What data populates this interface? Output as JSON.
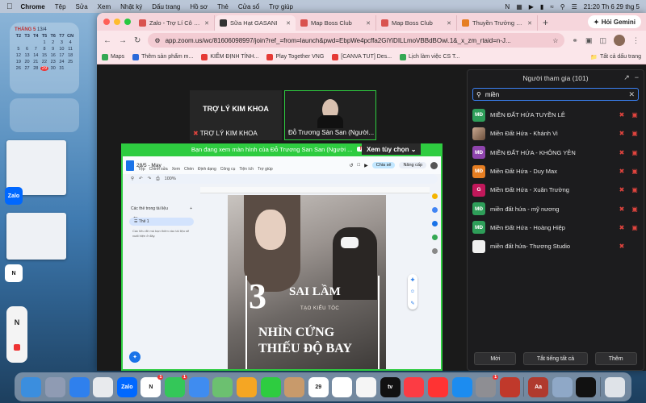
{
  "menubar": {
    "app": "Chrome",
    "items": [
      "Tệp",
      "Sửa",
      "Xem",
      "Nhật ký",
      "Dấu trang",
      "Hồ sơ",
      "Thẻ",
      "Cửa sổ",
      "Trợ giúp"
    ],
    "datetime": "21:20 Th 6 29 thg 5"
  },
  "calendar": {
    "month": "THÁNG 5",
    "year_label": "13/4",
    "days": [
      "T2",
      "T3",
      "T4",
      "T5",
      "T6",
      "T7",
      "CN"
    ],
    "dates": [
      "",
      "",
      "",
      "1",
      "2",
      "3",
      "4",
      "5",
      "6",
      "7",
      "8",
      "9",
      "10",
      "11",
      "12",
      "13",
      "14",
      "15",
      "16",
      "17",
      "18",
      "19",
      "20",
      "21",
      "22",
      "23",
      "24",
      "25",
      "26",
      "27",
      "28",
      "29",
      "30",
      "31"
    ],
    "today": "29"
  },
  "desktop": {
    "zalo_label": "Zalo"
  },
  "browser": {
    "tabs": [
      {
        "title": "Zalo - Trợ Lí Cô San",
        "color": "#d9534f"
      },
      {
        "title": "Sữa Hạt GASANI",
        "color": "#333333"
      },
      {
        "title": "Map Boss Club",
        "color": "#d9534f"
      },
      {
        "title": "Map Boss Club",
        "color": "#d9534f"
      },
      {
        "title": "Thuyền Trưởng x5 -",
        "color": "#e67e22"
      }
    ],
    "gemini_label": "Hỏi Gemini",
    "url": "app.zoom.us/wc/81606098997/join?ref_=from=launch&pwd=EbpWe4pcffa2GiYiDILLmoVBBdBOwi.1&_x_zm_rtaid=n-J...",
    "bookmarks": [
      {
        "label": "Maps",
        "color": "#34a853"
      },
      {
        "label": "Thêm sản phẩm m...",
        "color": "#2a6ad9"
      },
      {
        "label": "KIỂM ĐỊNH TÍNH...",
        "color": "#e53935"
      },
      {
        "label": "Play Together VNG",
        "color": "#e53935"
      },
      {
        "label": "[CANVA TUT] Des...",
        "color": "#e53935"
      },
      {
        "label": "Lịch làm việc CS T...",
        "color": "#34a853"
      }
    ],
    "all_bookmarks": "Tất cả dấu trang"
  },
  "zoom": {
    "tiles": [
      {
        "big": "TRỢ LÝ KIM KHOA",
        "name": "TRỢ LÝ KIM KHOA"
      },
      {
        "big": "",
        "name": "Đỗ Trương Sàn San (Người..."
      }
    ],
    "share_notice": "Bạn đang xem màn hình của  Đỗ Trương San San (Người ...",
    "rec": "REC",
    "view_options": "Xem tùy chọn",
    "docs": {
      "title": "28/5 - May",
      "menu": [
        "Tệp",
        "Chỉnh sửa",
        "Xem",
        "Chèn",
        "Định dạng",
        "Công cụ",
        "Tiện ích",
        "Trợ giúp"
      ],
      "share": "Chia sẻ",
      "upgrade": "Nâng cấp",
      "zoom": "100%",
      "sidebar_header": "Các thẻ trong tài liệu",
      "tab1": "Thẻ 1",
      "hint": "Các tiêu đề mà bạn thêm vào tài liệu sẽ xuất hiện ở đây.",
      "poster": {
        "num": "3",
        "line1": "SAI LẦM",
        "line2": "TẠO KIỂU TÓC",
        "line3": "NHÌN CỨNG",
        "line4": "THIẾU ĐỘ BAY"
      }
    },
    "participants": {
      "title": "Người tham gia (101)",
      "search": "miền",
      "list": [
        {
          "initials": "MĐ",
          "name": "MIỀN ĐẤT HỨA TUYỀN LÊ",
          "color": "#2e9e59",
          "cam": true
        },
        {
          "initials": "",
          "name": "Miền Đất Hứa - Khánh Vi",
          "color": "",
          "cam": true
        },
        {
          "initials": "MĐ",
          "name": "MIỀN ĐẤT HỨA - KHÔNG YÊN",
          "color": "#8e44ad",
          "cam": true
        },
        {
          "initials": "MĐ",
          "name": "Miền Đất Hứa - Duy Max",
          "color": "#e67e22",
          "cam": true
        },
        {
          "initials": "G",
          "name": "Miền Đất Hứa - Xuân Trường",
          "color": "#c2185b",
          "cam": true
        },
        {
          "initials": "MĐ",
          "name": "miền đất hứa - mỹ nương",
          "color": "#2e9e59",
          "cam": true
        },
        {
          "initials": "MĐ",
          "name": "Miền Đất Hứa - Hoàng Hiệp",
          "color": "#2e9e59",
          "cam": true
        },
        {
          "initials": "",
          "name": "miền đất hứa- Thương Studio",
          "color": "#f0f0f0",
          "cam": false
        }
      ],
      "invite": "Mời",
      "mute_all": "Tắt tiếng tất cả",
      "more": "Thêm"
    }
  },
  "dock": {
    "apps": [
      {
        "name": "finder-icon",
        "color": "#3b8ede",
        "label": ""
      },
      {
        "name": "launchpad-icon",
        "color": "#8f9bb3",
        "label": ""
      },
      {
        "name": "safari-icon",
        "color": "#2f80ed",
        "label": ""
      },
      {
        "name": "chrome-icon",
        "color": "#e8eaed",
        "label": ""
      },
      {
        "name": "zalo-icon",
        "color": "#0068ff",
        "label": "Zalo"
      },
      {
        "name": "notion-icon",
        "color": "#ffffff",
        "label": "N",
        "badge": "1"
      },
      {
        "name": "messages-icon",
        "color": "#34c759",
        "label": "",
        "badge": "1"
      },
      {
        "name": "mail-icon",
        "color": "#3f8cf0",
        "label": ""
      },
      {
        "name": "maps-icon",
        "color": "#6cc070",
        "label": ""
      },
      {
        "name": "photos-icon",
        "color": "#f5a623",
        "label": ""
      },
      {
        "name": "facetime-icon",
        "color": "#2ecc40",
        "label": ""
      },
      {
        "name": "contacts-icon",
        "color": "#c89a6b",
        "label": ""
      },
      {
        "name": "calendar-icon",
        "color": "#ffffff",
        "label": "29"
      },
      {
        "name": "reminders-icon",
        "color": "#ffffff",
        "label": ""
      },
      {
        "name": "freeform-icon",
        "color": "#f5f5f5",
        "label": ""
      },
      {
        "name": "tv-icon",
        "color": "#111111",
        "label": "tv"
      },
      {
        "name": "music-icon",
        "color": "#fc3c44",
        "label": ""
      },
      {
        "name": "news-icon",
        "color": "#f33",
        "label": ""
      },
      {
        "name": "appstore-icon",
        "color": "#1c8cf0",
        "label": ""
      },
      {
        "name": "settings-icon",
        "color": "#8e8e93",
        "label": "",
        "badge": "1"
      },
      {
        "name": "photobooth-icon",
        "color": "#c0392b",
        "label": ""
      },
      {
        "name": "dictionary-icon",
        "color": "#b03a2e",
        "label": "Aa"
      },
      {
        "name": "preview-icon",
        "color": "#8fa8c7",
        "label": ""
      },
      {
        "name": "capcut-icon",
        "color": "#111111",
        "label": ""
      },
      {
        "name": "trash-icon",
        "color": "#dfe3e8",
        "label": ""
      }
    ]
  }
}
